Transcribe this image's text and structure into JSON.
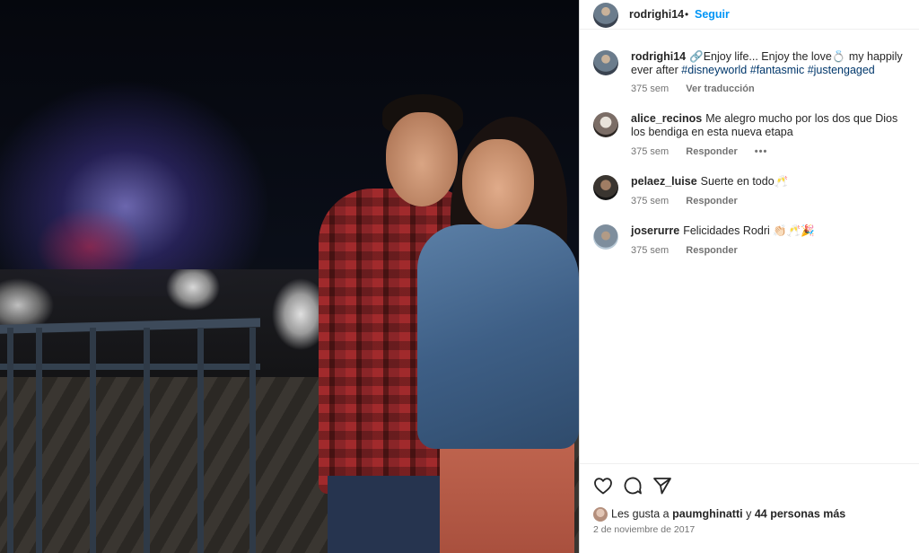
{
  "post": {
    "username": "rodrighi14",
    "follow_label": "Seguir",
    "separator": "•"
  },
  "caption": {
    "username": "rodrighi14",
    "text": "🔗Enjoy life... Enjoy the love💍 my happily ever after",
    "hashtags": [
      "#disneyworld",
      "#fantasmic",
      "#justengaged"
    ],
    "time": "375 sem",
    "translate_label": "Ver traducción"
  },
  "comments": [
    {
      "username": "alice_recinos",
      "text": "Me alegro mucho por los dos que Dios los bendiga en esta nueva etapa",
      "time": "375 sem",
      "reply_label": "Responder",
      "more": "•••"
    },
    {
      "username": "pelaez_luise",
      "text": "Suerte en todo🥂",
      "time": "375 sem",
      "reply_label": "Responder"
    },
    {
      "username": "joserurre",
      "text": "Felicidades Rodri 👏🏻🥂🎉",
      "time": "375 sem",
      "reply_label": "Responder"
    }
  ],
  "actions": {
    "like_icon": "heart-icon",
    "comment_icon": "comment-icon",
    "share_icon": "paper-plane-icon"
  },
  "likes": {
    "prefix": "Les gusta a",
    "user": "paumghinatti",
    "conjunction": "y",
    "others": "44 personas más"
  },
  "date": "2 de noviembre de 2017"
}
